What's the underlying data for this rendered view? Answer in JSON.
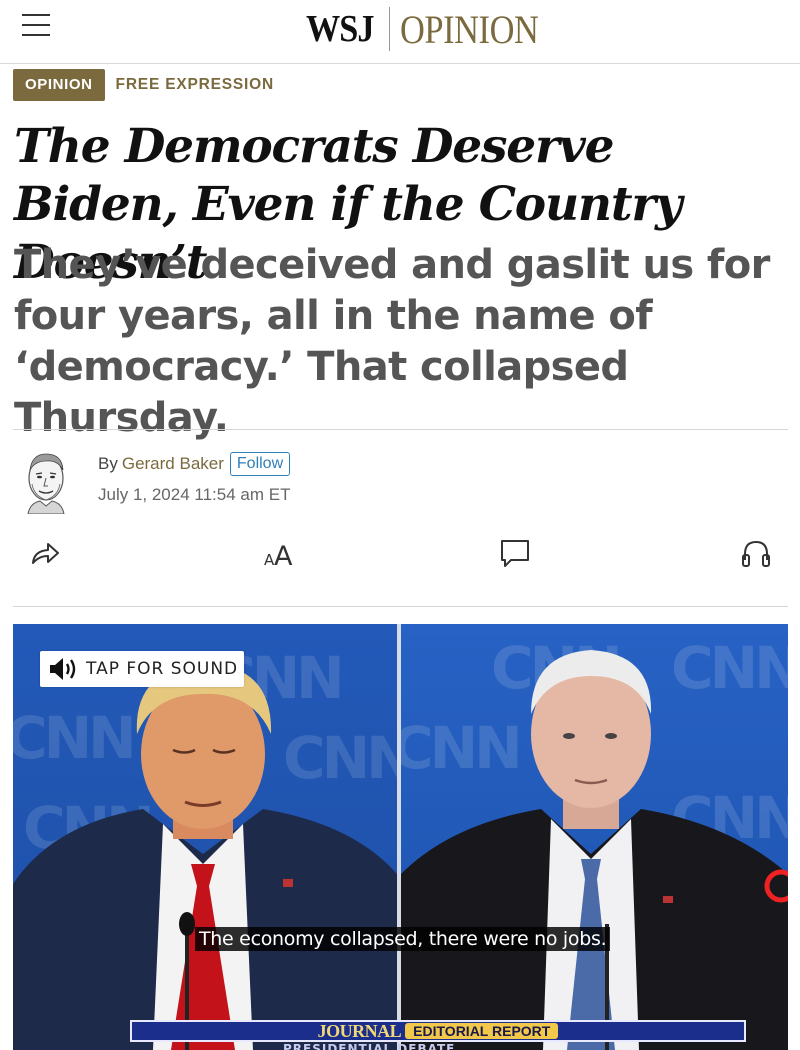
{
  "header": {
    "brand": "WSJ",
    "section_brand": "OPINION"
  },
  "tags": {
    "primary": "OPINION",
    "secondary": "FREE EXPRESSION"
  },
  "article": {
    "headline": "The Democrats Deserve Biden, Even if the Country Doesn’t",
    "dek": "They’ve deceived and gaslit us for four years, all in the name of ‘democracy.’ That collapsed Thursday.",
    "by_prefix": "By",
    "author": "Gerard Baker",
    "follow_label": "Follow",
    "date": "July 1, 2024 11:54 am ET"
  },
  "actions": [
    {
      "name": "share",
      "icon": "share-arrow-icon"
    },
    {
      "name": "text-size",
      "icon": "font-size-icon",
      "label": "AA"
    },
    {
      "name": "comments",
      "icon": "comment-bubble-icon"
    },
    {
      "name": "listen",
      "icon": "headphones-icon"
    }
  ],
  "video": {
    "sound_label": "TAP FOR SOUND",
    "caption": "The economy collapsed, there were no jobs.",
    "lower_third_brand": "JOURNAL",
    "lower_third_show": "EDITORIAL REPORT",
    "under_text": "PRESIDENTIAL DEBATE",
    "background_watermark": "CNN"
  },
  "colors": {
    "brand_gold": "#7a6a3e",
    "follow_blue": "#2f7fb8"
  }
}
